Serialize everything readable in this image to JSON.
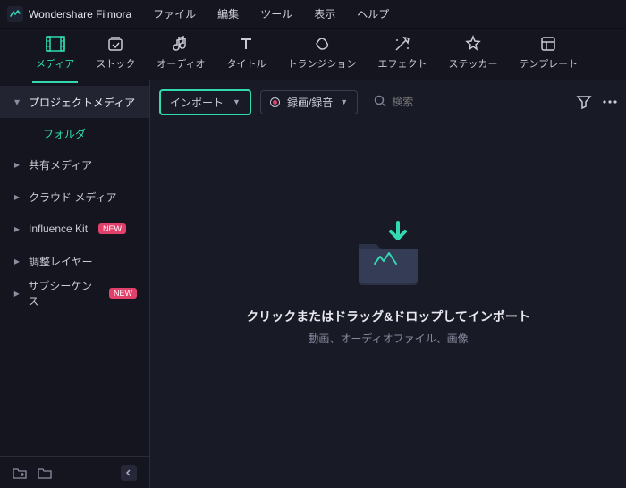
{
  "app": {
    "name": "Wondershare Filmora"
  },
  "menubar": [
    "ファイル",
    "編集",
    "ツール",
    "表示",
    "ヘルプ"
  ],
  "tabs": [
    {
      "label": "メディア",
      "icon": "media"
    },
    {
      "label": "ストック",
      "icon": "stock"
    },
    {
      "label": "オーディオ",
      "icon": "audio"
    },
    {
      "label": "タイトル",
      "icon": "title"
    },
    {
      "label": "トランジション",
      "icon": "transition"
    },
    {
      "label": "エフェクト",
      "icon": "effect"
    },
    {
      "label": "ステッカー",
      "icon": "sticker"
    },
    {
      "label": "テンプレート",
      "icon": "template"
    }
  ],
  "sidebar": {
    "items": [
      {
        "label": "プロジェクトメディア",
        "sub": "フォルダ",
        "selected": true,
        "expanded": true
      },
      {
        "label": "共有メディア"
      },
      {
        "label": "クラウド メディア"
      },
      {
        "label": "Influence Kit",
        "badge": "NEW"
      },
      {
        "label": "調整レイヤー"
      },
      {
        "label": "サブシーケンス",
        "badge": "NEW"
      }
    ]
  },
  "toolbar": {
    "import_label": "インポート",
    "record_label": "録画/録音",
    "search_placeholder": "検索"
  },
  "empty": {
    "title": "クリックまたはドラッグ&ドロップしてインポート",
    "subtitle": "動画、オーディオファイル、画像"
  }
}
